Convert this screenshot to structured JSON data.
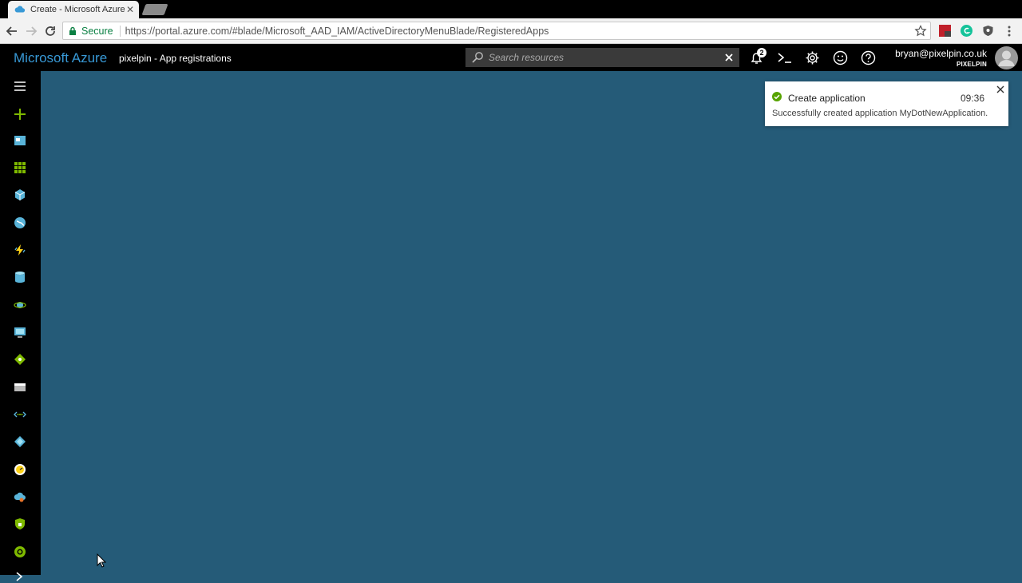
{
  "browser": {
    "tab_title": "Create - Microsoft Azure",
    "address": {
      "secure_label": "Secure",
      "url": "https://portal.azure.com/#blade/Microsoft_AAD_IAM/ActiveDirectoryMenuBlade/RegisteredApps"
    }
  },
  "azure": {
    "brand": "Microsoft Azure",
    "breadcrumb": "pixelpin - App registrations",
    "search_placeholder": "Search resources",
    "notification_count": "2",
    "user_email": "bryan@pixelpin.co.uk",
    "tenant": "PIXELPIN"
  },
  "sidebar": {
    "items": [
      "menu-icon",
      "create-resource-icon",
      "dashboard-icon",
      "all-services-icon",
      "resource-groups-icon",
      "app-services-icon",
      "function-apps-icon",
      "sql-databases-icon",
      "cosmos-db-icon",
      "virtual-machines-icon",
      "load-balancers-icon",
      "storage-accounts-icon",
      "virtual-networks-icon",
      "azure-ad-icon",
      "monitor-icon",
      "advisor-icon",
      "security-center-icon",
      "cost-management-icon",
      "more-services-icon"
    ]
  },
  "notification": {
    "title": "Create application",
    "time": "09:36",
    "message": "Successfully created application MyDotNewApplication."
  },
  "colors": {
    "content_background": "#255b78",
    "azure_blue": "#3899d6",
    "secure_green": "#0b8043",
    "success_green": "#57a300",
    "sidebar_accent": "#7fba00"
  }
}
